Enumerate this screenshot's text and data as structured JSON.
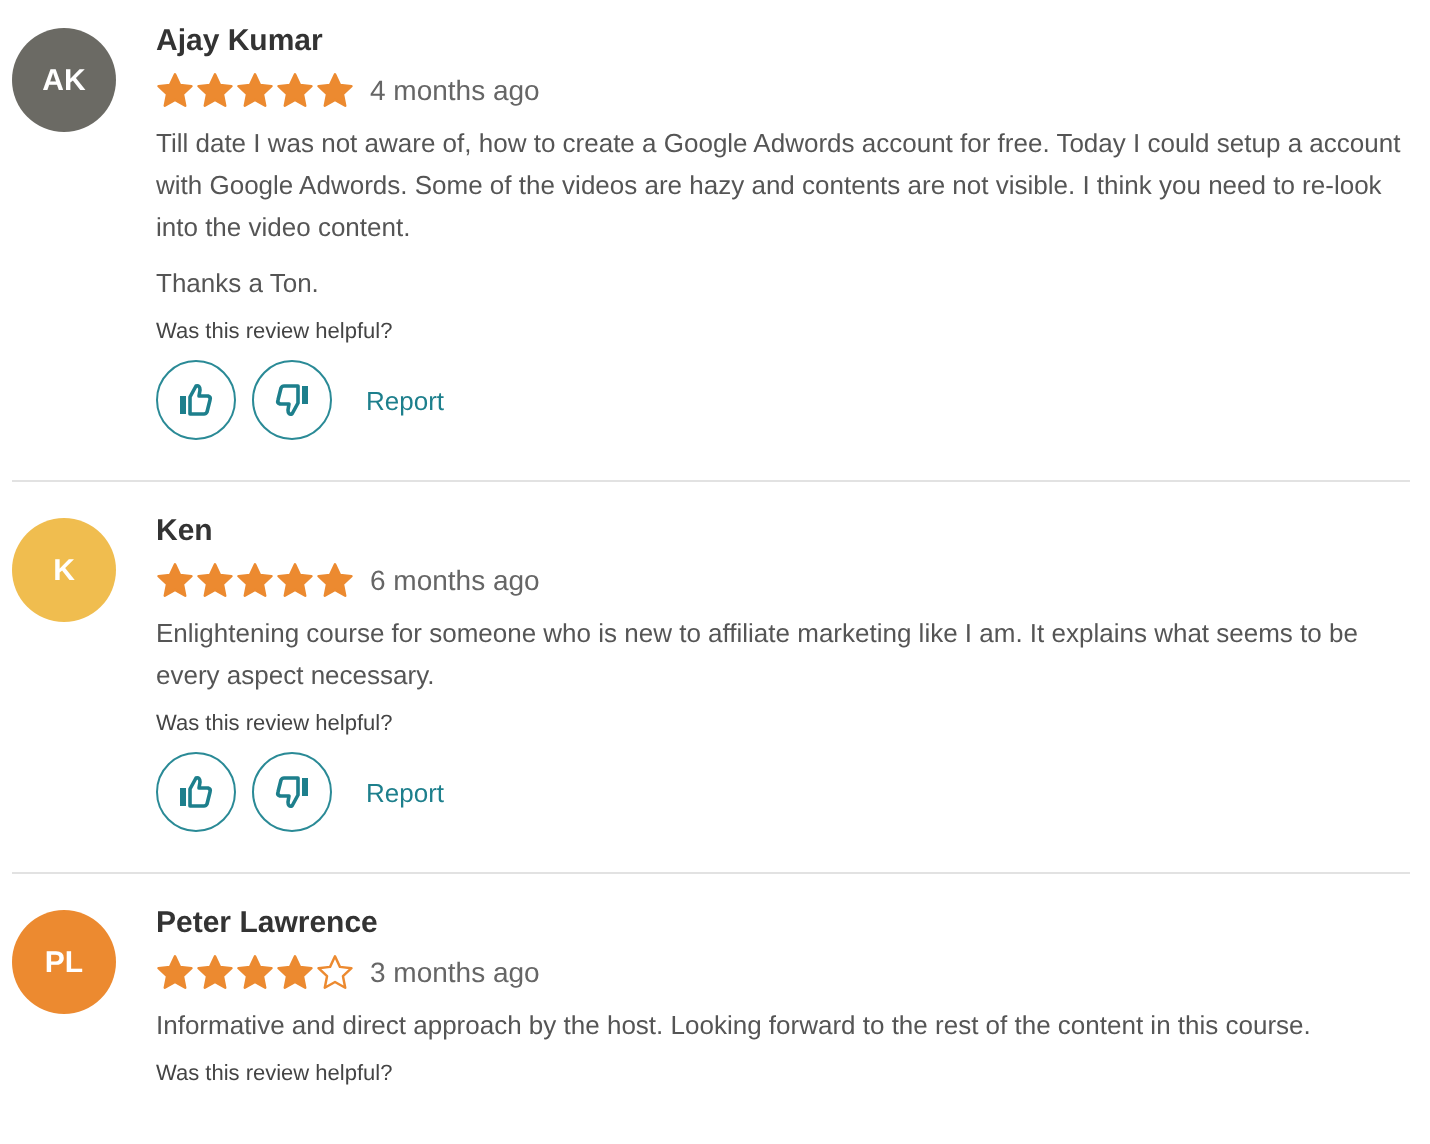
{
  "reviews": [
    {
      "initials": "AK",
      "color": "#6b6a64",
      "name": "Ajay Kumar",
      "stars": 5,
      "time": "4 months ago",
      "paragraphs": [
        "Till date I was not aware of, how to create a Google Adwords account for free. Today I could setup a account with Google Adwords. Some of the videos are hazy and contents are not visible. I think you need to re-look into the video content.",
        "Thanks a Ton."
      ],
      "helpful": "Was this review helpful?",
      "report": "Report"
    },
    {
      "initials": "K",
      "color": "#f0bd4f",
      "name": "Ken",
      "stars": 5,
      "time": "6 months ago",
      "paragraphs": [
        "Enlightening course for someone who is new to affiliate marketing like I am. It explains what seems to be every aspect necessary."
      ],
      "helpful": "Was this review helpful?",
      "report": "Report"
    },
    {
      "initials": "PL",
      "color": "#ec8a30",
      "name": "Peter Lawrence",
      "stars": 4,
      "time": "3 months ago",
      "paragraphs": [
        "Informative and direct approach by the host. Looking forward to the rest of the content in this course."
      ],
      "helpful": "Was this review helpful?"
    }
  ]
}
